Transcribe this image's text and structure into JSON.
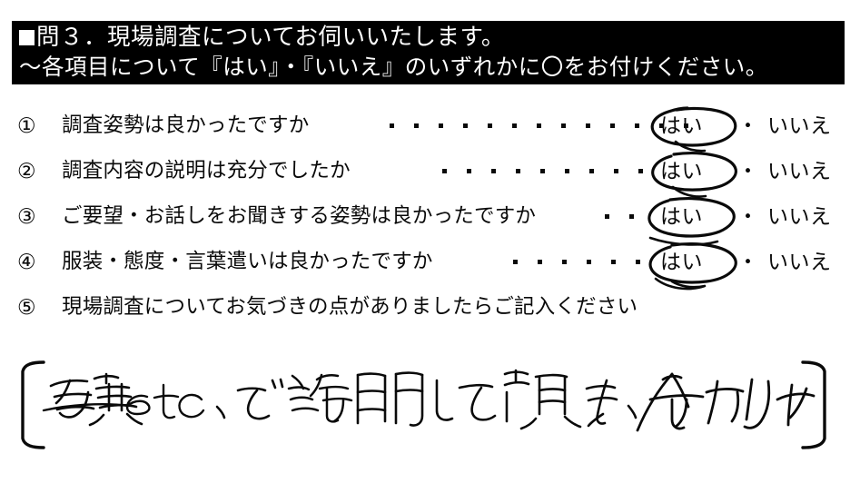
{
  "header": {
    "bullet_icon": "black-square",
    "line1": "問３．現場調査についてお伺いいたします。",
    "line2": "〜各項目について『はい』・『いいえ』のいずれかに〇をお付けください。",
    "background_color": "#000000",
    "text_color": "#ffffff"
  },
  "questions": [
    {
      "number": "①",
      "text": "調査姿勢は良かったですか",
      "dot_count": 13,
      "options": {
        "yes": "はい",
        "separator": "・",
        "no": "いいえ"
      },
      "selected": "はい",
      "marked": true
    },
    {
      "number": "②",
      "text": "調査内容の説明は充分でしたか",
      "dot_count": 9,
      "options": {
        "yes": "はい",
        "separator": "・",
        "no": "いいえ"
      },
      "selected": "はい",
      "marked": true
    },
    {
      "number": "③",
      "text": "ご要望・お話しをお聞きする姿勢は良かったですか",
      "dot_count": 2,
      "options": {
        "yes": "はい",
        "separator": "・",
        "no": "いいえ"
      },
      "selected": "はい",
      "marked": true
    },
    {
      "number": "④",
      "text": "服装・態度・言葉遣いは良かったですか",
      "dot_count": 6,
      "options": {
        "yes": "はい",
        "separator": "・",
        "no": "いいえ"
      },
      "selected": "はい",
      "marked": true
    },
    {
      "number": "⑤",
      "text": "現場調査についてお気づきの点がありましたらご記入ください",
      "dot_count": 0,
      "options": null,
      "selected": null,
      "marked": false
    }
  ],
  "comment_box": {
    "bracket_left": "[",
    "bracket_right": "]",
    "handwritten_text": "写真etc、で説明して頂き、分かりやすかった。"
  },
  "colors": {
    "page_background": "#ffffff",
    "ink": "#0a0a0a",
    "banner": "#000000"
  }
}
